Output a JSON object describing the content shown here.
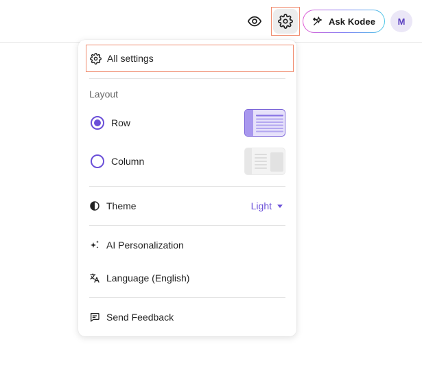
{
  "header": {
    "eye_icon": "eye-icon",
    "settings_icon": "gear-icon",
    "ask_button": {
      "label": "Ask Kodee",
      "icon": "sparkle-icon"
    },
    "avatar": {
      "initial": "M"
    }
  },
  "menu": {
    "all_settings": {
      "label": "All settings",
      "icon": "gear-icon"
    },
    "layout": {
      "title": "Layout",
      "options": [
        {
          "label": "Row",
          "selected": true
        },
        {
          "label": "Column",
          "selected": false
        }
      ]
    },
    "theme": {
      "label": "Theme",
      "value": "Light",
      "icon": "contrast-icon"
    },
    "items": [
      {
        "label": "AI Personalization",
        "icon": "sparkles-icon"
      },
      {
        "label": "Language (English)",
        "icon": "translate-icon"
      },
      {
        "label": "Send Feedback",
        "icon": "feedback-icon"
      }
    ]
  },
  "colors": {
    "accent": "#6a4fd8",
    "highlight_border": "#f08a6c"
  }
}
